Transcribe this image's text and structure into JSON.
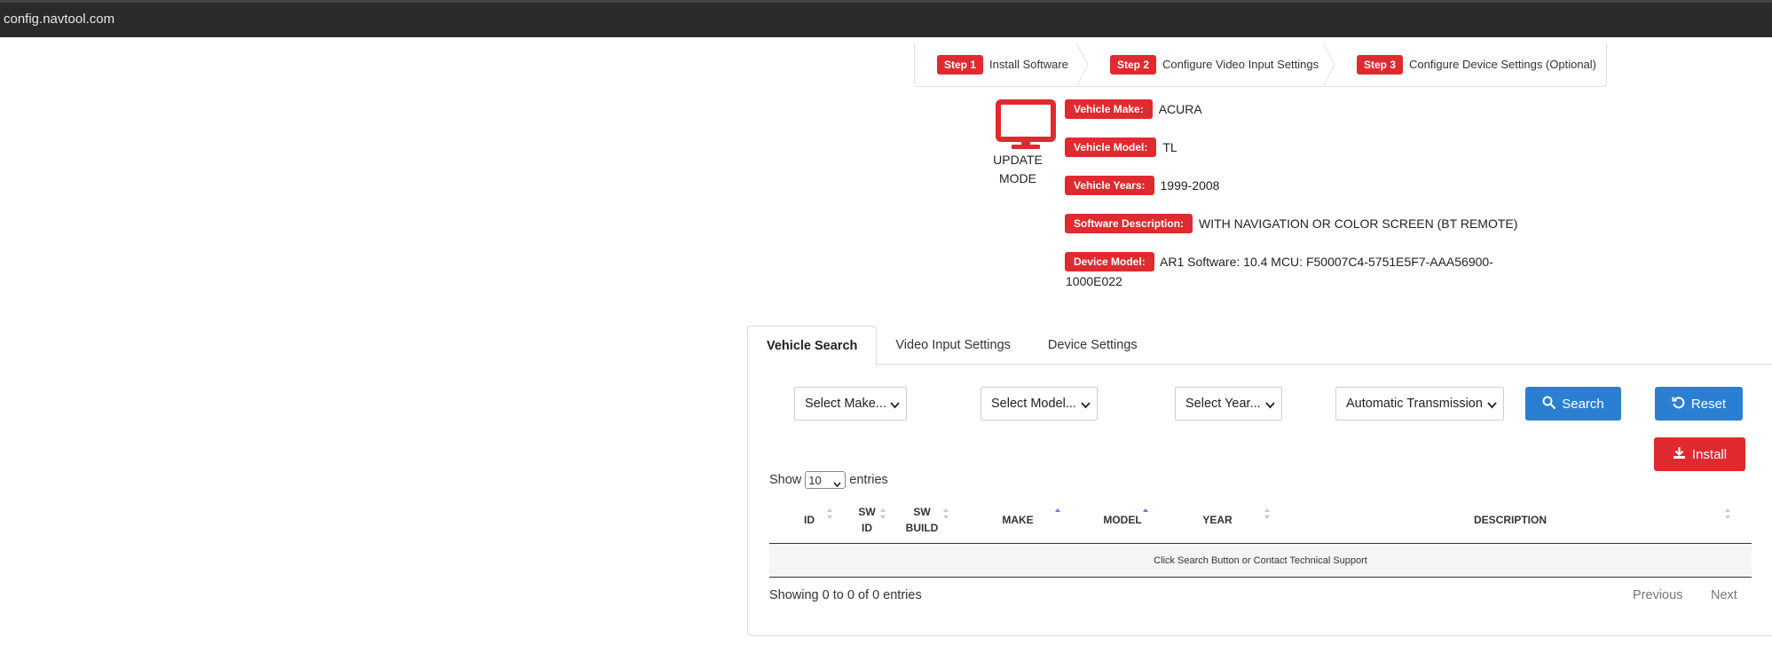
{
  "browser": {
    "url": "config.navtool.com"
  },
  "steps": [
    {
      "badge": "Step 1",
      "label": "Install Software"
    },
    {
      "badge": "Step 2",
      "label": "Configure Video Input Settings"
    },
    {
      "badge": "Step 3",
      "label": "Configure Device Settings (Optional)"
    }
  ],
  "mode": {
    "line1": "UPDATE",
    "line2": "MODE"
  },
  "vehicle_info": {
    "make": {
      "label": "Vehicle Make:",
      "value": "ACURA"
    },
    "model": {
      "label": "Vehicle Model:",
      "value": "TL"
    },
    "years": {
      "label": "Vehicle Years:",
      "value": "1999-2008"
    },
    "software": {
      "label": "Software Description:",
      "value": "WITH NAVIGATION OR COLOR SCREEN (BT REMOTE)"
    },
    "device": {
      "label": "Device Model:",
      "value": "AR1  Software: 10.4  MCU: F50007C4-5751E5F7-AAA56900-1000E022"
    }
  },
  "tabs": [
    {
      "label": "Vehicle Search",
      "active": true
    },
    {
      "label": "Video Input Settings",
      "active": false
    },
    {
      "label": "Device Settings",
      "active": false
    }
  ],
  "filters": {
    "make": "Select Make...",
    "model": "Select Model...",
    "year": "Select Year...",
    "transmission": "Automatic Transmission"
  },
  "buttons": {
    "search": "Search",
    "reset": "Reset",
    "install": "Install"
  },
  "table": {
    "show_label": "Show",
    "entries_label": "entries",
    "page_length": "10",
    "columns": {
      "id": "ID",
      "sw_id": "SW ID",
      "sw_build": "SW BUILD",
      "make": "MAKE",
      "model": "MODEL",
      "year": "YEAR",
      "description": "DESCRIPTION"
    },
    "empty_message": "Click Search Button or Contact Technical Support",
    "info": "Showing 0 to 0 of 0 entries",
    "previous": "Previous",
    "next": "Next"
  },
  "colors": {
    "accent_red": "#e02a2f",
    "accent_blue": "#2b7fd1",
    "sort_active": "#7b6fe0"
  }
}
